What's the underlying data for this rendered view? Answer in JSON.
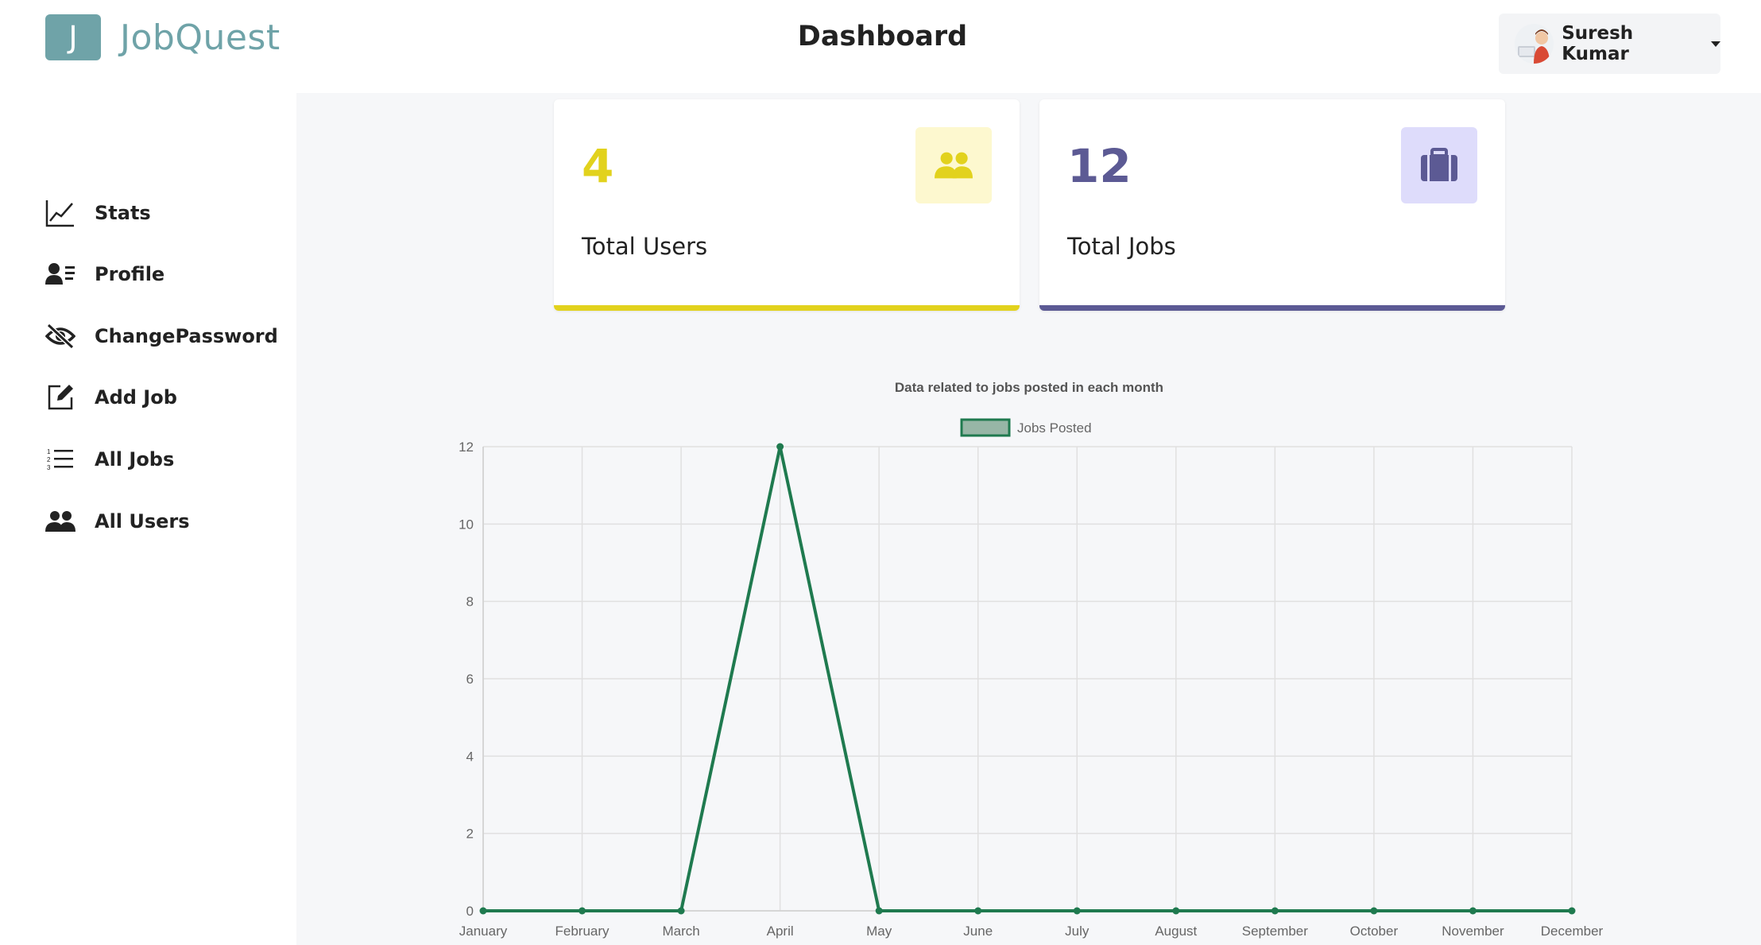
{
  "app": {
    "logo_letter": "J",
    "name": "JobQuest"
  },
  "header": {
    "title": "Dashboard",
    "user_name": "Suresh Kumar"
  },
  "sidebar": {
    "items": [
      {
        "label": "Stats",
        "icon": "line-chart-icon"
      },
      {
        "label": "Profile",
        "icon": "profile-card-icon"
      },
      {
        "label": "ChangePassword",
        "icon": "eye-slash-icon"
      },
      {
        "label": "Add Job",
        "icon": "edit-icon"
      },
      {
        "label": "All Jobs",
        "icon": "list-icon"
      },
      {
        "label": "All Users",
        "icon": "users-icon"
      }
    ]
  },
  "stats": [
    {
      "value": "4",
      "label": "Total Users",
      "icon": "users-icon",
      "color": "#e2d21d",
      "icon_bg": "#fdf8cf"
    },
    {
      "value": "12",
      "label": "Total Jobs",
      "icon": "briefcase-icon",
      "color": "#5c5a94",
      "icon_bg": "#dedcfb"
    }
  ],
  "chart_data": {
    "type": "line",
    "title": "Data related to jobs posted in each month",
    "categories": [
      "January",
      "February",
      "March",
      "April",
      "May",
      "June",
      "July",
      "August",
      "September",
      "October",
      "November",
      "December"
    ],
    "series": [
      {
        "name": "Jobs Posted",
        "values": [
          0,
          0,
          0,
          12,
          0,
          0,
          0,
          0,
          0,
          0,
          0,
          0
        ],
        "color": "#1f7a4f",
        "legend_fill": "#97b6a6"
      }
    ],
    "ylim": [
      0,
      12
    ],
    "yticks": [
      "0",
      "2",
      "4",
      "6",
      "8",
      "10",
      "12"
    ],
    "grid": true,
    "legend_position": "top-center"
  }
}
